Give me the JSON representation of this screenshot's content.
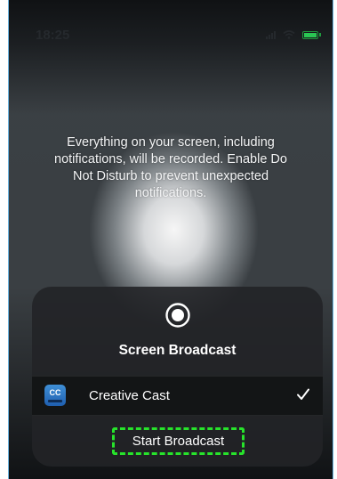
{
  "status_bar": {
    "time": "18:25"
  },
  "info": {
    "lines": [
      "Everything on your screen, including",
      "notifications, will be recorded. Enable Do",
      "Not Disturb to prevent unexpected",
      "notifications."
    ]
  },
  "sheet": {
    "title": "Screen Broadcast",
    "provider": {
      "icon_text": "CC",
      "name": "Creative Cast",
      "selected": true
    },
    "start_label": "Start Broadcast"
  },
  "colors": {
    "highlight": "#27e32b",
    "battery": "#2ac653",
    "sheet_bg": "#222427"
  }
}
